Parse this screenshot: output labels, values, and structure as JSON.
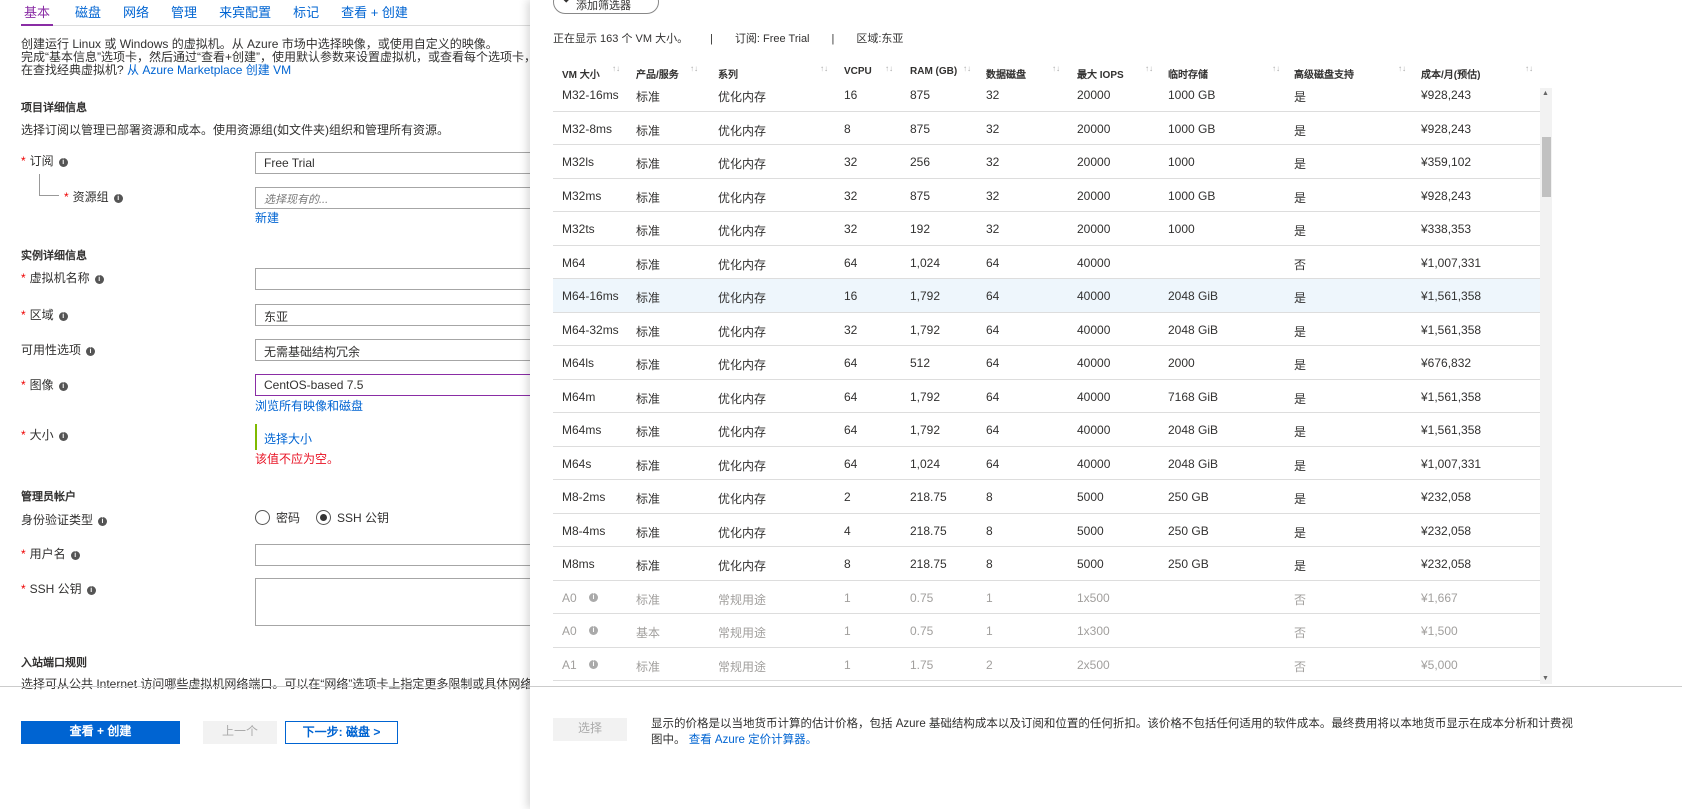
{
  "tabs": [
    "基本",
    "磁盘",
    "网络",
    "管理",
    "来宾配置",
    "标记",
    "查看 + 创建"
  ],
  "intro": {
    "line1": "创建运行 Linux 或 Windows 的虚拟机。从 Azure 市场中选择映像，或使用自定义的映像。",
    "line2": "完成“基本信息”选项卡，然后通过“查看+创建”，使用默认参数来设置虚拟机，或查看每个选项卡，全部",
    "line3": "在查找经典虚拟机?",
    "line3_link": "从 Azure Marketplace 创建 VM"
  },
  "project": {
    "heading": "项目详细信息",
    "desc": "选择订阅以管理已部署资源和成本。使用资源组(如文件夹)组织和管理所有资源。",
    "subscription_label": "订阅",
    "subscription_value": "Free Trial",
    "rg_label": "资源组",
    "rg_placeholder": "选择现有的...",
    "rg_new": "新建"
  },
  "instance": {
    "heading": "实例详细信息",
    "name_label": "虚拟机名称",
    "region_label": "区域",
    "region_value": "东亚",
    "avail_label": "可用性选项",
    "avail_value": "无需基础结构冗余",
    "image_label": "图像",
    "image_value": "CentOS-based 7.5",
    "image_link": "浏览所有映像和磁盘",
    "size_label": "大小",
    "size_link": "选择大小",
    "size_error": "该值不应为空。"
  },
  "admin": {
    "heading": "管理员帐户",
    "auth_label": "身份验证类型",
    "opt_password": "密码",
    "opt_ssh": "SSH 公钥",
    "user_label": "用户名",
    "ssh_label": "SSH 公钥"
  },
  "ports": {
    "heading": "入站端口规则",
    "desc": "选择可从公共 Internet 访问哪些虚拟机网络端口。可以在“网络”选项卡上指定更多限制或具体网络访问。"
  },
  "footer": {
    "review": "查看 + 创建",
    "prev": "上一个",
    "next": "下一步: 磁盘 >"
  },
  "panel": {
    "filter": "添加筛选器",
    "showing": "正在显示 163 个 VM 大小。",
    "sep": "|",
    "subscription": "订阅: Free Trial",
    "region": "区域:东亚",
    "select": "选择",
    "note1": "显示的价格是以当地货币计算的估计价格，包括 Azure 基础结构成本以及订阅和位置的任何折扣。该价格不包括任何适用的软件成本。最终费用将以本地货币显示在成本分析和计费视",
    "note2": "图中。",
    "note_link": "查看 Azure 定价计算器。"
  },
  "columns": [
    "VM 大小",
    "产品/服务",
    "系列",
    "VCPU",
    "RAM (GB)",
    "数据磁盘",
    "最大 IOPS",
    "临时存储",
    "高级磁盘支持",
    "成本/月(预估)"
  ],
  "rows": [
    [
      "M32-16ms",
      "标准",
      "优化内存",
      "16",
      "875",
      "32",
      "20000",
      "1000 GB",
      "是",
      "¥928,243"
    ],
    [
      "M32-8ms",
      "标准",
      "优化内存",
      "8",
      "875",
      "32",
      "20000",
      "1000 GB",
      "是",
      "¥928,243"
    ],
    [
      "M32ls",
      "标准",
      "优化内存",
      "32",
      "256",
      "32",
      "20000",
      "1000",
      "是",
      "¥359,102"
    ],
    [
      "M32ms",
      "标准",
      "优化内存",
      "32",
      "875",
      "32",
      "20000",
      "1000 GB",
      "是",
      "¥928,243"
    ],
    [
      "M32ts",
      "标准",
      "优化内存",
      "32",
      "192",
      "32",
      "20000",
      "1000",
      "是",
      "¥338,353"
    ],
    [
      "M64",
      "标准",
      "优化内存",
      "64",
      "1,024",
      "64",
      "40000",
      "",
      "否",
      "¥1,007,331"
    ],
    [
      "M64-16ms",
      "标准",
      "优化内存",
      "16",
      "1,792",
      "64",
      "40000",
      "2048 GiB",
      "是",
      "¥1,561,358"
    ],
    [
      "M64-32ms",
      "标准",
      "优化内存",
      "32",
      "1,792",
      "64",
      "40000",
      "2048 GiB",
      "是",
      "¥1,561,358"
    ],
    [
      "M64ls",
      "标准",
      "优化内存",
      "64",
      "512",
      "64",
      "40000",
      "2000",
      "是",
      "¥676,832"
    ],
    [
      "M64m",
      "标准",
      "优化内存",
      "64",
      "1,792",
      "64",
      "40000",
      "7168 GiB",
      "是",
      "¥1,561,358"
    ],
    [
      "M64ms",
      "标准",
      "优化内存",
      "64",
      "1,792",
      "64",
      "40000",
      "2048 GiB",
      "是",
      "¥1,561,358"
    ],
    [
      "M64s",
      "标准",
      "优化内存",
      "64",
      "1,024",
      "64",
      "40000",
      "2048 GiB",
      "是",
      "¥1,007,331"
    ],
    [
      "M8-2ms",
      "标准",
      "优化内存",
      "2",
      "218.75",
      "8",
      "5000",
      "250 GB",
      "是",
      "¥232,058"
    ],
    [
      "M8-4ms",
      "标准",
      "优化内存",
      "4",
      "218.75",
      "8",
      "5000",
      "250 GB",
      "是",
      "¥232,058"
    ],
    [
      "M8ms",
      "标准",
      "优化内存",
      "8",
      "218.75",
      "8",
      "5000",
      "250 GB",
      "是",
      "¥232,058"
    ],
    [
      "A0",
      "标准",
      "常规用途",
      "1",
      "0.75",
      "1",
      "1x500",
      "",
      "否",
      "¥1,667"
    ],
    [
      "A0",
      "基本",
      "常规用途",
      "1",
      "0.75",
      "1",
      "1x300",
      "",
      "否",
      "¥1,500"
    ],
    [
      "A1",
      "标准",
      "常规用途",
      "1",
      "1.75",
      "2",
      "2x500",
      "",
      "否",
      "¥5,000"
    ]
  ],
  "disabled_from": 15,
  "selected_row": 6
}
